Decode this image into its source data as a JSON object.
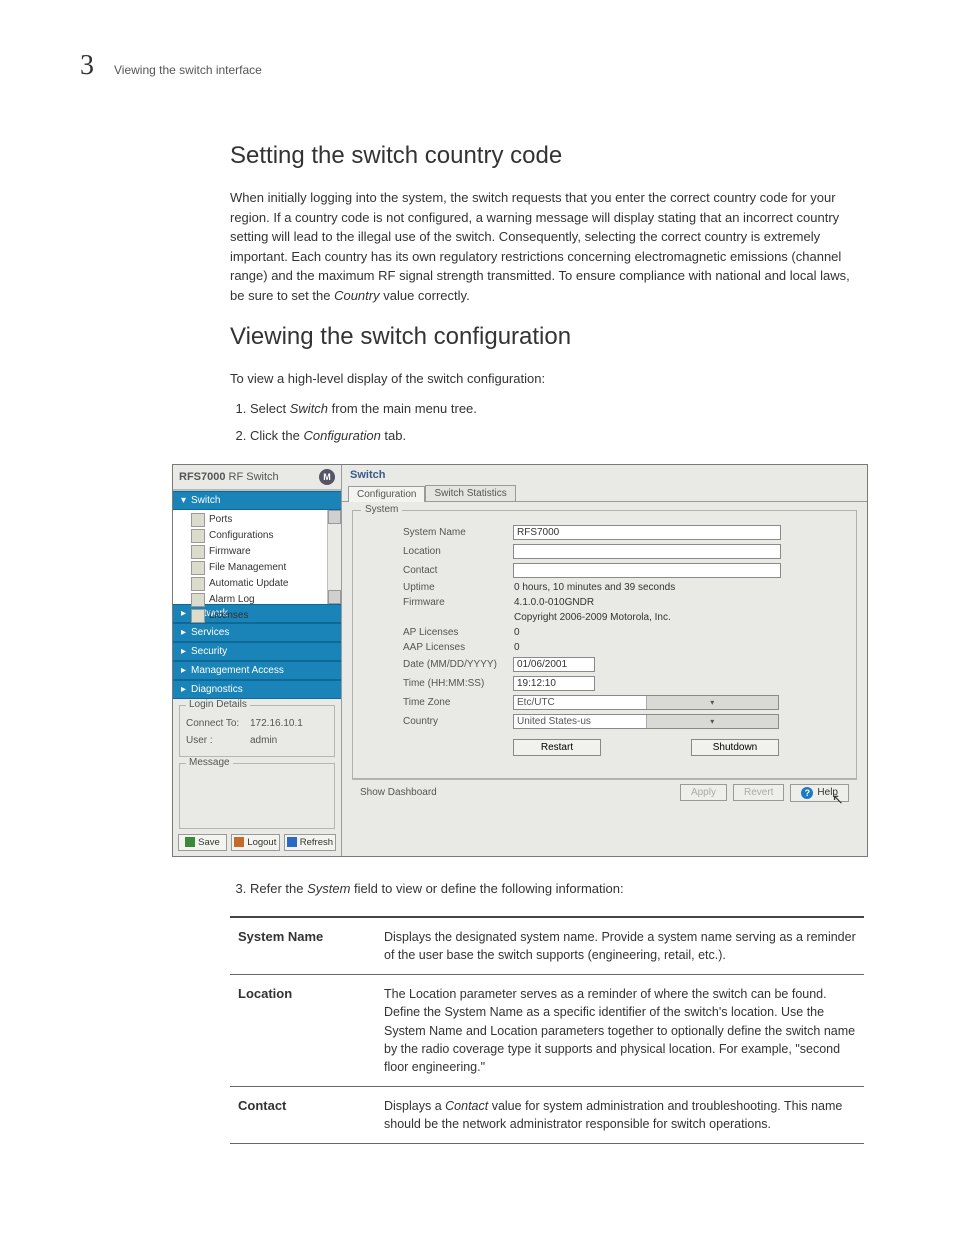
{
  "header": {
    "chapter": "3",
    "running": "Viewing the switch interface"
  },
  "section1": {
    "title": "Setting the switch country code",
    "body": "When initially logging into the system, the switch requests that you enter the correct country code for your region. If a country code is not configured, a warning message will display stating that an incorrect country setting will lead to the illegal use of the switch. Consequently, selecting the correct country is extremely important. Each country has its own regulatory restrictions concerning electromagnetic emissions (channel range) and the maximum RF signal strength transmitted. To ensure compliance with national and local laws, be sure to set the ",
    "body_em": "Country",
    "body_after": " value correctly."
  },
  "section2": {
    "title": "Viewing the switch configuration",
    "intro": "To view a high-level display of the switch configuration:",
    "steps": [
      {
        "pre": "Select ",
        "em": "Switch",
        "post": " from the main menu tree."
      },
      {
        "pre": "Click the ",
        "em": "Configuration",
        "post": " tab."
      }
    ],
    "step3": {
      "pre": "Refer the ",
      "em": "System",
      "post": " field to view or define the following information:"
    }
  },
  "app": {
    "left_title_bold": "RFS7000",
    "left_title_rest": " RF Switch",
    "logo": "M",
    "tree": {
      "switch": {
        "label": "Switch",
        "items": [
          "Ports",
          "Configurations",
          "Firmware",
          "File Management",
          "Automatic Update",
          "Alarm Log",
          "Licenses"
        ]
      },
      "others": [
        "Network",
        "Services",
        "Security",
        "Management Access",
        "Diagnostics"
      ]
    },
    "login": {
      "legend": "Login Details",
      "rows": [
        {
          "k": "Connect To:",
          "v": "172.16.10.1"
        },
        {
          "k": "User :",
          "v": "admin"
        }
      ]
    },
    "message_legend": "Message",
    "bottom": {
      "save": "Save",
      "logout": "Logout",
      "refresh": "Refresh"
    },
    "right": {
      "title": "Switch",
      "tabs": [
        "Configuration",
        "Switch Statistics"
      ],
      "active_tab": 0,
      "fieldset": "System",
      "fields": {
        "system_name": {
          "label": "System Name",
          "value": "RFS7000"
        },
        "location": {
          "label": "Location",
          "value": ""
        },
        "contact": {
          "label": "Contact",
          "value": ""
        },
        "uptime": {
          "label": "Uptime",
          "text": "0 hours, 10 minutes and 39 seconds"
        },
        "firmware": {
          "label": "Firmware",
          "text": "4.1.0.0-010GNDR"
        },
        "copyright": "Copyright 2006-2009 Motorola, Inc.",
        "ap_licenses": {
          "label": "AP Licenses",
          "text": "0"
        },
        "aap_licenses": {
          "label": "AAP Licenses",
          "text": "0"
        },
        "date": {
          "label": "Date (MM/DD/YYYY)",
          "value": "01/06/2001"
        },
        "time": {
          "label": "Time (HH:MM:SS)",
          "value": "19:12:10"
        },
        "timezone": {
          "label": "Time Zone",
          "value": "Etc/UTC"
        },
        "country": {
          "label": "Country",
          "value": "United States-us"
        }
      },
      "buttons": {
        "restart": "Restart",
        "shutdown": "Shutdown"
      },
      "footer": {
        "show_dashboard": "Show Dashboard",
        "apply": "Apply",
        "revert": "Revert",
        "help": "Help"
      }
    }
  },
  "defs": [
    {
      "term": "System Name",
      "desc": "Displays the designated system name. Provide a system name serving as a reminder of the user base the switch supports (engineering, retail, etc.)."
    },
    {
      "term": "Location",
      "desc": "The Location parameter serves as a reminder of where the switch can be found. Define the System Name as a specific identifier of the switch's location. Use the System Name and Location parameters together to optionally define the switch name by the radio coverage type it supports and physical location. For example, \"second floor engineering.\""
    },
    {
      "term": "Contact",
      "desc_pre": "Displays a ",
      "desc_em": "Contact",
      "desc_post": " value for system administration and troubleshooting. This name should be the network administrator responsible for switch operations."
    }
  ]
}
